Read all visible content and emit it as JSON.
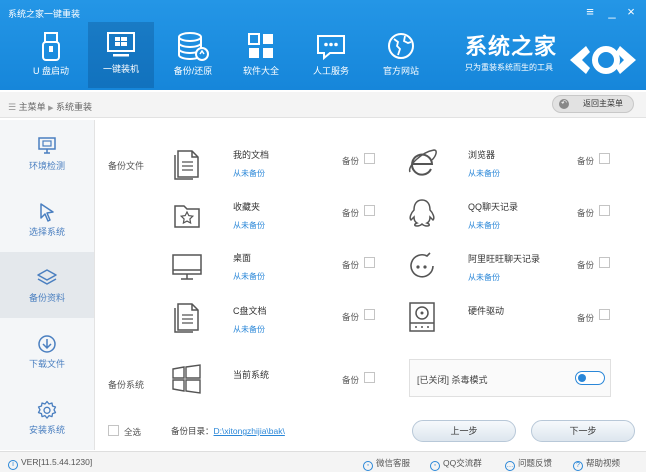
{
  "window": {
    "title": "系统之家一键重装",
    "controls": [
      "≡",
      "_",
      "×"
    ]
  },
  "nav": [
    {
      "label": "U 盘启动",
      "icon": "usb-drive-icon"
    },
    {
      "label": "一键装机",
      "icon": "monitor-windows-icon",
      "active": true
    },
    {
      "label": "备份/还原",
      "icon": "database-backup-icon"
    },
    {
      "label": "软件大全",
      "icon": "app-grid-icon"
    },
    {
      "label": "人工服务",
      "icon": "chat-bubble-icon"
    },
    {
      "label": "官方网站",
      "icon": "globe-icon"
    }
  ],
  "brand": {
    "title": "系统之家",
    "subtitle": "只为重装系统而生的工具"
  },
  "breadcrumb": {
    "home": "主菜单",
    "separator": "▶",
    "current": "系统重装",
    "back_button": "返回主菜单"
  },
  "sidebar": [
    {
      "label": "环境检测",
      "icon": "environment-check-icon"
    },
    {
      "label": "选择系统",
      "icon": "cursor-select-icon"
    },
    {
      "label": "备份资料",
      "icon": "layers-backup-icon",
      "active": true
    },
    {
      "label": "下载文件",
      "icon": "download-icon"
    },
    {
      "label": "安装系统",
      "icon": "gear-install-icon"
    }
  ],
  "backup_files": {
    "section_label": "备份文件",
    "backup_label": "备份",
    "items": [
      {
        "name": "我的文档",
        "status": "从未备份",
        "icon": "document-icon"
      },
      {
        "name": "收藏夹",
        "status": "从未备份",
        "icon": "favorites-folder-icon"
      },
      {
        "name": "桌面",
        "status": "从未备份",
        "icon": "desktop-monitor-icon"
      },
      {
        "name": "C盘文档",
        "status": "从未备份",
        "icon": "c-drive-document-icon"
      },
      {
        "name": "浏览器",
        "status": "从未备份",
        "icon": "ie-browser-icon"
      },
      {
        "name": "QQ聊天记录",
        "status": "从未备份",
        "icon": "qq-penguin-icon"
      },
      {
        "name": "阿里旺旺聊天记录",
        "status": "从未备份",
        "icon": "aliwangwang-icon"
      },
      {
        "name": "硬件驱动",
        "status": "",
        "icon": "hardware-driver-icon"
      }
    ]
  },
  "backup_system": {
    "section_label": "备份系统",
    "item_name": "当前系统",
    "backup_label": "备份",
    "toggle_label": "[已关闭] 杀毒模式",
    "toggle_on": false
  },
  "footer": {
    "select_all": "全选",
    "path_label": "备份目录：",
    "path_value": "D:\\xitongzhijia\\bak\\",
    "prev_button": "上一步",
    "next_button": "下一步"
  },
  "statusbar": {
    "version": "VER[11.5.44.1230]",
    "wechat": "微信客服",
    "qq_group": "QQ交流群",
    "feedback": "问题反馈",
    "help_video": "帮助视频"
  },
  "colors": {
    "header_blue": "#1e8ee0",
    "link_blue": "#2a87d8",
    "icon_blue": "#4a7fc0"
  }
}
